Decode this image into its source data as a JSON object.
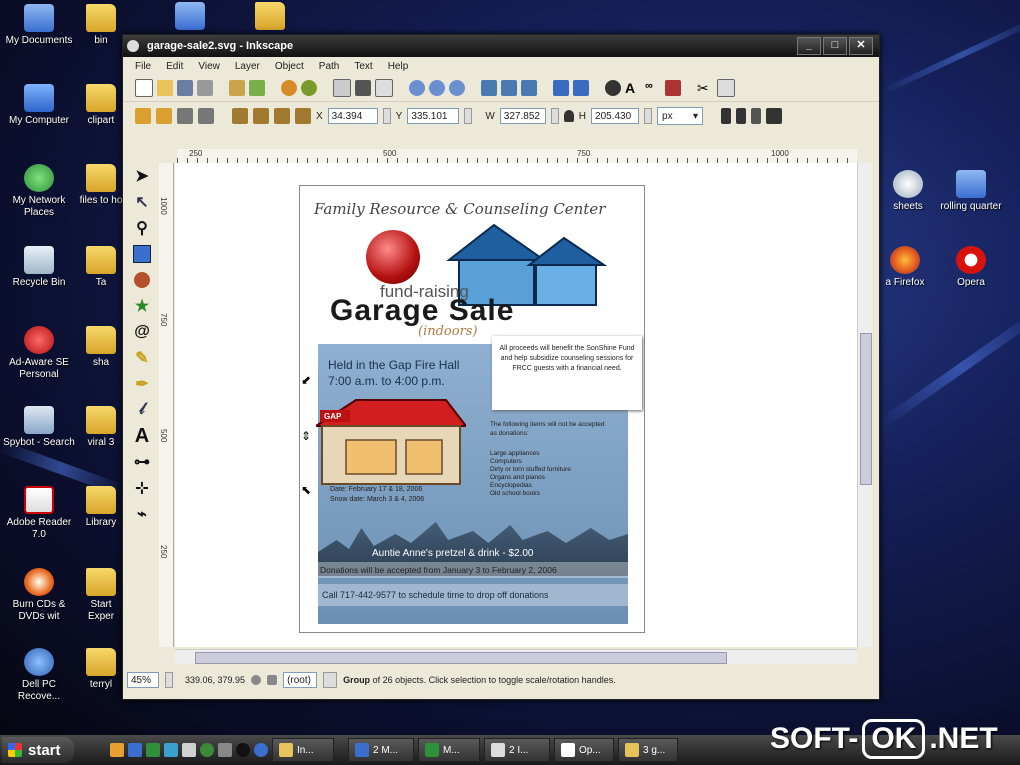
{
  "desktop": {
    "left_icons": [
      {
        "label": "My Documents",
        "icon": "my-documents-icon"
      },
      {
        "label": "My Computer",
        "icon": "my-computer-icon"
      },
      {
        "label": "My Network Places",
        "icon": "network-places-icon"
      },
      {
        "label": "Recycle Bin",
        "icon": "recycle-bin-icon"
      },
      {
        "label": "Ad-Aware SE Personal",
        "icon": "ad-aware-icon"
      },
      {
        "label": "Spybot - Search",
        "icon": "spybot-icon"
      },
      {
        "label": "Adobe Reader 7.0",
        "icon": "adobe-reader-icon"
      },
      {
        "label": "Burn CDs & DVDs wit",
        "icon": "burn-cd-icon"
      },
      {
        "label": "Dell PC Recove...",
        "icon": "dell-recovery-icon"
      }
    ],
    "second_col_icons": [
      {
        "label": "bin"
      },
      {
        "label": "clipart"
      },
      {
        "label": "files to ho"
      },
      {
        "label": "Ta"
      },
      {
        "label": "sha"
      },
      {
        "label": "viral 3"
      },
      {
        "label": "Library"
      },
      {
        "label": "Start Exper"
      },
      {
        "label": "terryl"
      }
    ],
    "right_icons": [
      {
        "label": "sheets",
        "icon": "clock-icon"
      },
      {
        "label": "rolling quarter",
        "icon": "document-icon"
      },
      {
        "label": "a Firefox",
        "icon": "firefox-icon"
      },
      {
        "label": "Opera",
        "icon": "opera-icon"
      }
    ]
  },
  "window": {
    "title": "garage-sale2.svg - Inkscape",
    "controls": {
      "minimize": "_",
      "maximize": "□",
      "close": "✕"
    },
    "menu": [
      "File",
      "Edit",
      "View",
      "Layer",
      "Object",
      "Path",
      "Text",
      "Help"
    ],
    "coords": {
      "x_label": "X",
      "x": "34.394",
      "y_label": "Y",
      "y": "335.101",
      "w_label": "W",
      "w": "327.852",
      "h_label": "H",
      "h": "205.430",
      "unit": "px"
    },
    "ruler_labels": [
      "250",
      "500",
      "750",
      "1000"
    ],
    "vruler_labels": [
      "1000",
      "750",
      "500",
      "250"
    ],
    "status": {
      "zoom": "45%",
      "cursor": "339.06, 379.95",
      "layer": "(root)",
      "message_bold": "Group",
      "message": " of 26 objects. Click selection to toggle scale/rotation handles."
    }
  },
  "flyer": {
    "org": "Family Resource & Counseling Center",
    "fund": "fund-raising",
    "sale": "Garage Sale",
    "indoors": "(indoors)",
    "held": "Held in the Gap Fire Hall",
    "time": "7:00 a.m. to 4:00 p.m.",
    "proceeds": "All proceeds will benefit the SonShine Fund and help subsidize counseling sessions for FRCC guests with a financial need.",
    "gap_sign": "GAP",
    "items_intro": "The following items will not be accepted as donations:",
    "items": [
      "Large appliances",
      "Computers",
      "Dirty or torn stuffed furniture",
      "Organs and pianos",
      "Encyclopedias",
      "Old school books"
    ],
    "date": "Date: February 17 & 18, 2006",
    "snow_date": "Snow date: March 3 & 4, 2006",
    "pretzel": "Auntie Anne's pretzel & drink - $2.00",
    "donations": "Donations will be accepted from January 3 to February 2, 2006",
    "call": "Call 717-442-9577 to schedule time to drop off donations"
  },
  "taskbar": {
    "start": "start",
    "tasks": [
      "In...",
      "2 M...",
      "M...",
      "2 I...",
      "Op..."
    ],
    "tray": "3 g..."
  },
  "watermark": {
    "left": "SOFT-",
    "ok": "OK",
    "right": ".NET"
  }
}
